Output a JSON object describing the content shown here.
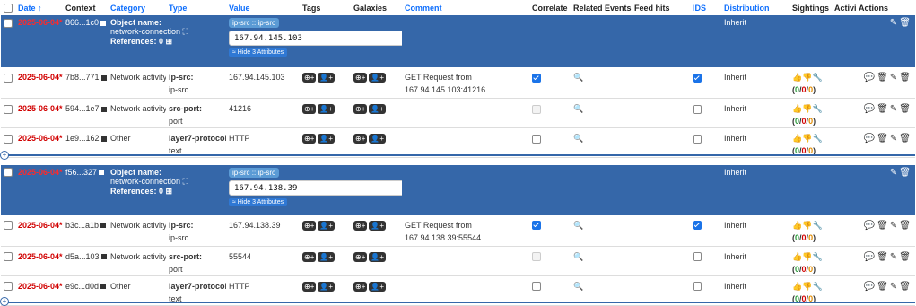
{
  "columns": {
    "date": "Date ↑",
    "context": "Context",
    "category": "Category",
    "type": "Type",
    "value": "Value",
    "tags": "Tags",
    "galaxies": "Galaxies",
    "comment": "Comment",
    "correlate": "Correlate",
    "related": "Related Events",
    "feed": "Feed hits",
    "ids": "IDS",
    "distribution": "Distribution",
    "sightings": "Sightings",
    "activity": "Activity",
    "actions": "Actions"
  },
  "hide_label": "≈ Hide 3 Attributes",
  "objects": [
    {
      "date": "2025-06-04*",
      "uuid": "866...1c0",
      "name_label": "Object name:",
      "name": "network-connection",
      "refs": "References: 0",
      "tag": "ip-src :: ip-src",
      "value": "167.94.145.103",
      "distribution": "Inherit",
      "attrs": [
        {
          "date": "2025-06-04*",
          "uuid": "7b8...771",
          "category": "Network activity",
          "type": "ip-src:",
          "subtype": "ip-src",
          "value": "167.94.145.103",
          "comment1": "GET Request from",
          "comment2": "167.94.145.103:41216",
          "correlate": "on",
          "ids": "on",
          "distribution": "Inherit"
        },
        {
          "date": "2025-06-04*",
          "uuid": "594...1e7",
          "category": "Network activity",
          "type": "src-port:",
          "subtype": "port",
          "value": "41216",
          "comment1": "",
          "comment2": "",
          "correlate": "dis",
          "ids": "off",
          "distribution": "Inherit"
        },
        {
          "date": "2025-06-04*",
          "uuid": "1e9...162",
          "category": "Other",
          "type": "layer7-protocol:",
          "subtype": "text",
          "value": "HTTP",
          "comment1": "",
          "comment2": "",
          "correlate": "off",
          "ids": "off",
          "distribution": "Inherit"
        }
      ]
    },
    {
      "date": "2025-06-04*",
      "uuid": "f56...327",
      "name_label": "Object name:",
      "name": "network-connection",
      "refs": "References: 0",
      "tag": "ip-src :: ip-src",
      "value": "167.94.138.39",
      "distribution": "Inherit",
      "attrs": [
        {
          "date": "2025-06-04*",
          "uuid": "b3c...a1b",
          "category": "Network activity",
          "type": "ip-src:",
          "subtype": "ip-src",
          "value": "167.94.138.39",
          "comment1": "GET Request from",
          "comment2": "167.94.138.39:55544",
          "correlate": "on",
          "ids": "on",
          "distribution": "Inherit"
        },
        {
          "date": "2025-06-04*",
          "uuid": "d5a...103",
          "category": "Network activity",
          "type": "src-port:",
          "subtype": "port",
          "value": "55544",
          "comment1": "",
          "comment2": "",
          "correlate": "dis",
          "ids": "off",
          "distribution": "Inherit"
        },
        {
          "date": "2025-06-04*",
          "uuid": "e9c...d0d",
          "category": "Other",
          "type": "layer7-protocol:",
          "subtype": "text",
          "value": "HTTP",
          "comment1": "",
          "comment2": "",
          "correlate": "off",
          "ids": "off",
          "distribution": "Inherit"
        }
      ]
    }
  ],
  "sightings_counts": {
    "a": "0",
    "b": "0",
    "c": "0"
  }
}
